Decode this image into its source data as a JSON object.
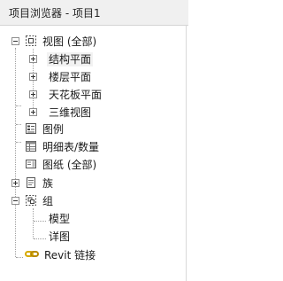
{
  "window": {
    "title": "项目浏览器 - 项目1"
  },
  "tree": {
    "views": {
      "label": "视图 (全部)",
      "children": [
        "结构平面",
        "楼层平面",
        "天花板平面",
        "三维视图"
      ]
    },
    "legends": "图例",
    "schedules": "明细表/数量",
    "sheets": "图纸 (全部)",
    "families": "族",
    "groups": {
      "label": "组",
      "children": [
        "模型",
        "详图"
      ]
    },
    "revit_links": "Revit 链接"
  },
  "colors": {
    "link_icon": "#d6a900",
    "selection": "#f2f2f2"
  }
}
